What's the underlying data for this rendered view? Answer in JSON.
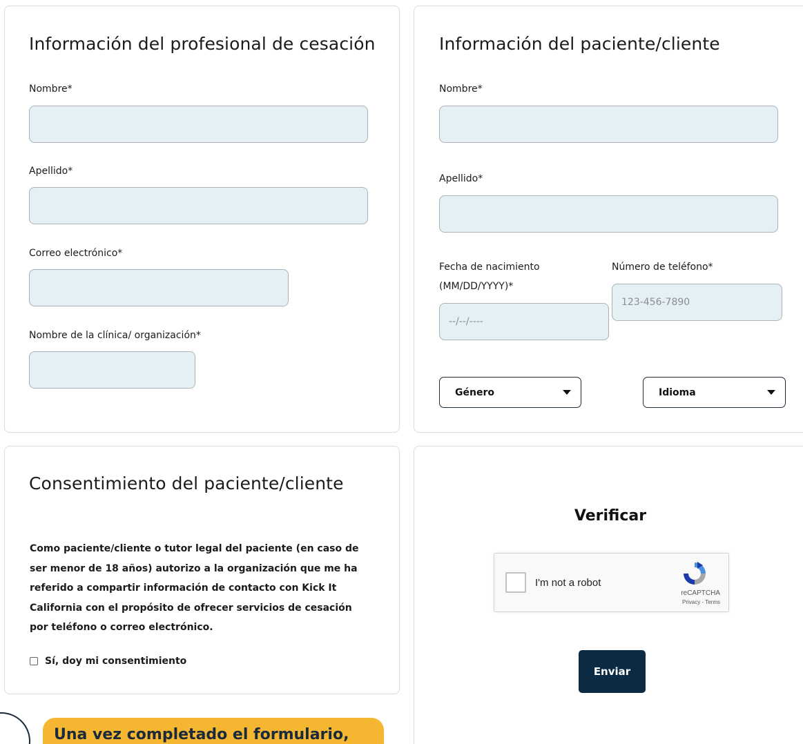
{
  "professional": {
    "title": "Información del profesional de cesación",
    "first_name_label": "Nombre*",
    "last_name_label": "Apellido*",
    "email_label": "Correo electrónico*",
    "org_label": "Nombre de la clínica/ organización*"
  },
  "patient": {
    "title": "Información del paciente/cliente",
    "first_name_label": "Nombre*",
    "last_name_label": "Apellido*",
    "dob_label_line1": "Fecha de nacimiento",
    "dob_label_line2": "(MM/DD/YYYY)*",
    "dob_placeholder": "--/--/----",
    "phone_label": "Número de teléfono*",
    "phone_placeholder": "123-456-7890",
    "gender_select": "Género",
    "language_select": "Idioma"
  },
  "consent": {
    "title": "Consentimiento del paciente/cliente",
    "body": "Como paciente/cliente o tutor legal del paciente (en caso de ser menor de 18 años) autorizo a la organización que me ha referido a compartir información de contacto con Kick It California con el propósito de ofrecer servicios de cesación por teléfono o correo electrónico.",
    "checkbox_label": "Sí, doy mi consentimiento"
  },
  "verify": {
    "title": "Verificar",
    "recaptcha_label": "I'm not a robot",
    "recaptcha_brand": "reCAPTCHA",
    "recaptcha_terms": "Privacy - Terms",
    "submit_label": "Enviar"
  },
  "callout": {
    "text": "Una vez completado el formulario,"
  },
  "colors": {
    "field_bg": "#e5f0f5",
    "button_bg": "#0b2b45",
    "callout_bg": "#f5b731"
  }
}
